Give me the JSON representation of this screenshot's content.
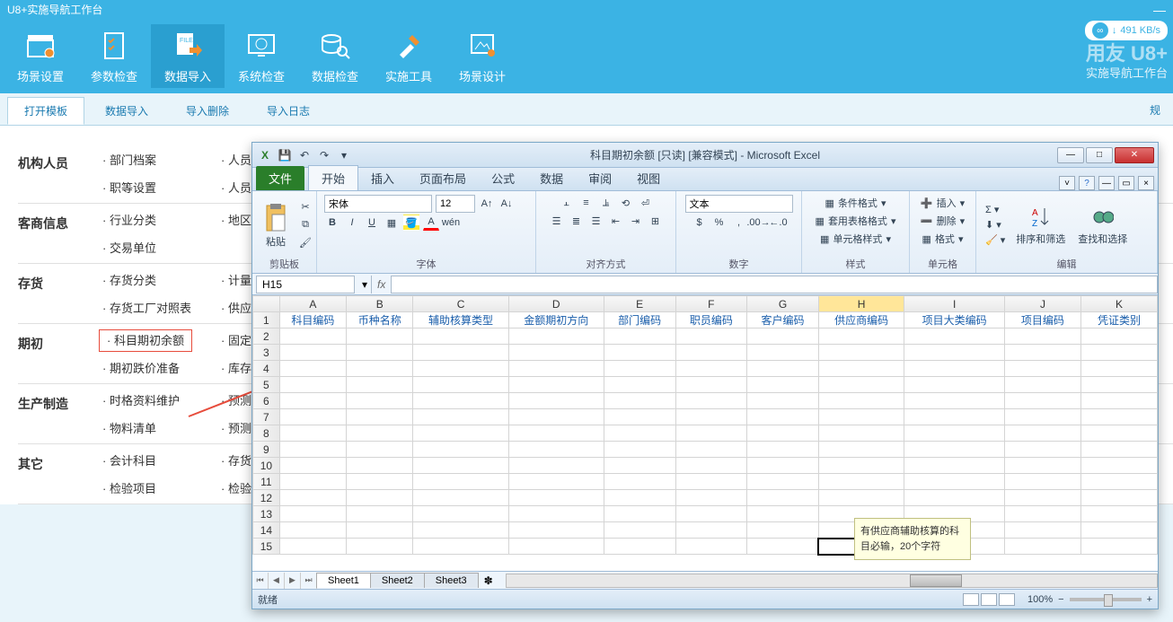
{
  "app": {
    "title": "U8+实施导航工作台"
  },
  "speed": "491 KB/s",
  "brand": {
    "logo": "用友 U8+",
    "subtitle": "实施导航工作台"
  },
  "ribbon": [
    {
      "label": "场景设置"
    },
    {
      "label": "参数检查"
    },
    {
      "label": "数据导入"
    },
    {
      "label": "系统检查"
    },
    {
      "label": "数据检查"
    },
    {
      "label": "实施工具"
    },
    {
      "label": "场景设计"
    }
  ],
  "tabs": [
    "打开模板",
    "数据导入",
    "导入删除",
    "导入日志"
  ],
  "right_text": "规",
  "categories": [
    {
      "title": "机构人员",
      "rows": [
        [
          "· 部门档案",
          "· 人员"
        ],
        [
          "· 职等设置",
          "· 人员"
        ]
      ]
    },
    {
      "title": "客商信息",
      "rows": [
        [
          "· 行业分类",
          "· 地区"
        ],
        [
          "· 交易单位",
          ""
        ]
      ]
    },
    {
      "title": "存货",
      "rows": [
        [
          "· 存货分类",
          "· 计量"
        ],
        [
          "· 存货工厂对照表",
          "· 供应"
        ]
      ]
    },
    {
      "title": "期初",
      "rows": [
        [
          "· 科目期初余额",
          "· 固定"
        ],
        [
          "· 期初跌价准备",
          "· 库存"
        ]
      ]
    },
    {
      "title": "生产制造",
      "rows": [
        [
          "· 时格资料维护",
          "· 预测"
        ],
        [
          "· 物料清单",
          "· 预测"
        ]
      ]
    },
    {
      "title": "其它",
      "rows": [
        [
          "· 会计科目",
          "· 存货"
        ],
        [
          "· 检验项目",
          "· 检验"
        ]
      ]
    }
  ],
  "highlight": "· 科目期初余额",
  "excel": {
    "title": "科目期初余额 [只读] [兼容模式] - Microsoft Excel",
    "file_tab": "文件",
    "tabs": [
      "开始",
      "插入",
      "页面布局",
      "公式",
      "数据",
      "审阅",
      "视图"
    ],
    "groups": {
      "clipboard": {
        "label": "剪贴板",
        "paste": "粘贴"
      },
      "font": {
        "label": "字体",
        "name": "宋体",
        "size": "12"
      },
      "align": {
        "label": "对齐方式"
      },
      "number": {
        "label": "数字",
        "format": "文本"
      },
      "styles": {
        "label": "样式",
        "cond": "条件格式",
        "table": "套用表格格式",
        "cell": "单元格样式"
      },
      "cells": {
        "label": "单元格",
        "insert": "插入",
        "delete": "删除",
        "format": "格式"
      },
      "editing": {
        "label": "编辑",
        "sort": "排序和筛选",
        "find": "查找和选择"
      }
    },
    "name_box": "H15",
    "fx": "fx",
    "columns": [
      "A",
      "B",
      "C",
      "D",
      "E",
      "F",
      "G",
      "H",
      "I",
      "J",
      "K"
    ],
    "headers": [
      "科目编码",
      "币种名称",
      "辅助核算类型",
      "金额期初方向",
      "部门编码",
      "职员编码",
      "客户编码",
      "供应商编码",
      "项目大类编码",
      "项目编码",
      "凭证类别"
    ],
    "rows": 15,
    "sheets": [
      "Sheet1",
      "Sheet2",
      "Sheet3"
    ],
    "status": "就绪",
    "zoom": "100%",
    "tooltip": "有供应商辅助核算的科目必输，20个字符"
  }
}
